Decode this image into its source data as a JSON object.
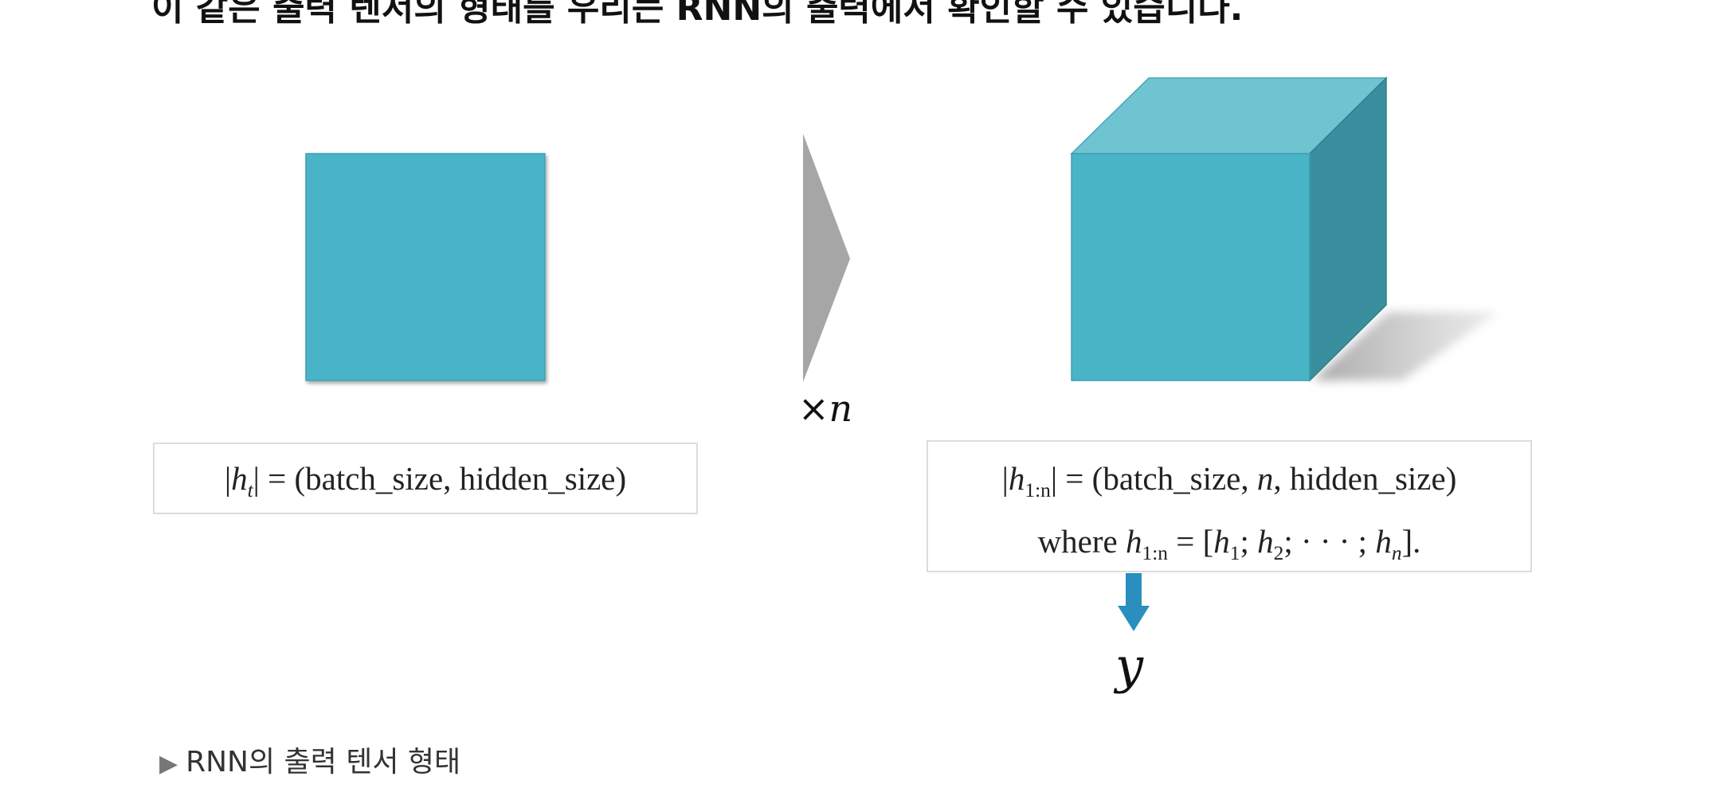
{
  "top_text": "이 같은 출력 텐서의 형태를 우리는 RNN의 출력에서 확인할 수 있습니다.",
  "left_formula": {
    "lhs_open": "|",
    "var": "h",
    "sub": "t",
    "lhs_close": "|",
    "rhs": " = (batch_size, hidden_size)"
  },
  "times_label": {
    "symbol": "×",
    "var": "n"
  },
  "right_formula": {
    "line1_open": "|",
    "line1_var": "h",
    "line1_sub": "1:n",
    "line1_close": "|",
    "line1_rhs_pre": " = (batch_size, ",
    "line1_rhs_n": "n",
    "line1_rhs_post": ", hidden_size)",
    "line2_where": "where ",
    "line2_var": "h",
    "line2_sub": "1:n",
    "line2_eq": " = [",
    "line2_h1": "h",
    "line2_s1": "1",
    "line2_sep1": "; ",
    "line2_h2": "h",
    "line2_s2": "2",
    "line2_sep2": "; · · · ; ",
    "line2_hn": "h",
    "line2_sn": "n",
    "line2_end": "]."
  },
  "output_label": "y",
  "caption": {
    "marker": "▶",
    "text": "RNN의 출력 텐서 형태"
  },
  "colors": {
    "square_fill": "#4ab4c7",
    "cube_front": "#4ab4c7",
    "cube_top": "#6fc4d1",
    "cube_side": "#3a8f9e",
    "arrow_gray": "#a6a6a6",
    "down_arrow": "#2a8fbf"
  }
}
